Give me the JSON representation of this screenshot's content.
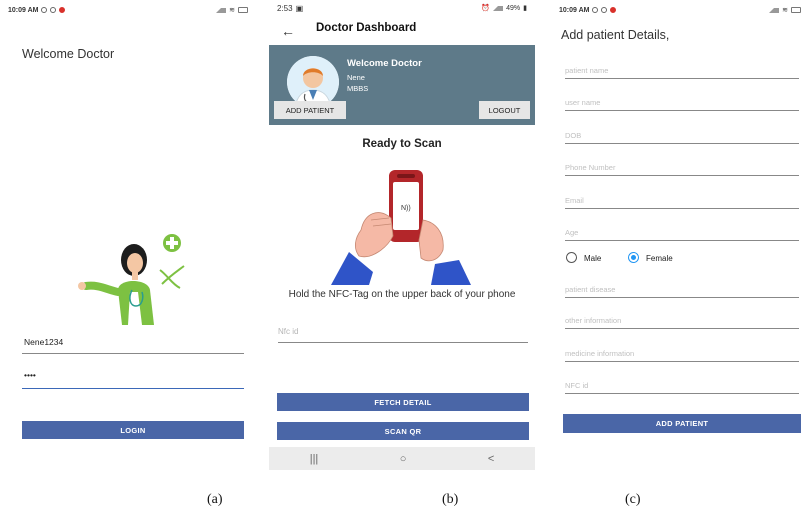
{
  "phone_a": {
    "status_time": "10:09 AM",
    "welcome": "Welcome Doctor",
    "username_value": "Nene1234",
    "password_value": "••••",
    "login_label": "LOGIN",
    "caption": "(a)"
  },
  "phone_b": {
    "status_time": "2:53",
    "battery": "49%",
    "title": "Doctor Dashboard",
    "header": {
      "title": "Welcome Doctor",
      "name": "Nene",
      "degree": "MBBS"
    },
    "add_patient_label": "ADD PATIENT",
    "logout_label": "LOGOUT",
    "scan_title": "Ready to Scan",
    "hold_text": "Hold the NFC-Tag on the upper back of your phone",
    "nfc_placeholder": "Nfc id",
    "fetch_label": "FETCH DETAIL",
    "scan_qr_label": "SCAN QR",
    "nav": {
      "recent": "|||",
      "home": "○",
      "back": "<"
    },
    "caption": "(b)"
  },
  "phone_c": {
    "status_time": "10:09 AM",
    "title": "Add patient Details,",
    "placeholders": {
      "patient_name": "patient name",
      "user_name": "user name",
      "dob": "DOB",
      "phone": "Phone Number",
      "email": "Email",
      "age": "Age",
      "disease": "patient disease",
      "other": "other information",
      "medicine": "medicine information",
      "nfc": "NFC id"
    },
    "gender": {
      "male": "Male",
      "female": "Female",
      "selected": "Female"
    },
    "add_label": "ADD PATIENT",
    "caption": "(c)"
  },
  "colors": {
    "primary_button": "#4a66a7",
    "header_panel": "#5e7a89",
    "radio_accent": "#2196f3",
    "focus_underline": "#3b68b8"
  }
}
